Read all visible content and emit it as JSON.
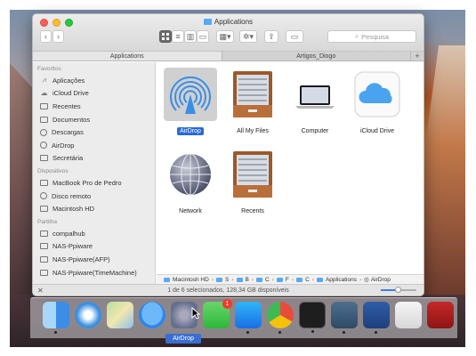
{
  "window": {
    "title": "Applications",
    "search_placeholder": "Pesquisa",
    "tabs": [
      {
        "label": "Applications",
        "active": true
      },
      {
        "label": "Artigos_Diogo",
        "active": false
      }
    ]
  },
  "sidebar": {
    "favorites_header": "Favoritos",
    "favorites": [
      {
        "label": "Aplicações",
        "icon": "applications-icon"
      },
      {
        "label": "iCloud Drive",
        "icon": "cloud-icon"
      },
      {
        "label": "Recentes",
        "icon": "recents-icon"
      },
      {
        "label": "Documentos",
        "icon": "document-icon"
      },
      {
        "label": "Descargas",
        "icon": "download-icon"
      },
      {
        "label": "AirDrop",
        "icon": "airdrop-icon"
      },
      {
        "label": "Secretária",
        "icon": "desktop-icon"
      }
    ],
    "devices_header": "Dispositivos",
    "devices": [
      {
        "label": "MacBook Pro de Pedro",
        "icon": "laptop-icon"
      },
      {
        "label": "Disco remoto",
        "icon": "disc-icon"
      },
      {
        "label": "Macintosh HD",
        "icon": "harddisk-icon"
      }
    ],
    "shared_header": "Partilha",
    "shared": [
      {
        "label": "compalhub",
        "icon": "network-drive-icon"
      },
      {
        "label": "NAS-Ppiware",
        "icon": "network-drive-icon"
      },
      {
        "label": "NAS-Ppiware(AFP)",
        "icon": "network-drive-icon"
      },
      {
        "label": "NAS-Ppiware(TimeMachine)",
        "icon": "network-drive-icon"
      }
    ]
  },
  "content": {
    "items": [
      {
        "label": "AirDrop",
        "icon": "airdrop-icon",
        "selected": true
      },
      {
        "label": "All My Files",
        "icon": "drawer-icon",
        "selected": false
      },
      {
        "label": "Computer",
        "icon": "laptop-icon",
        "selected": false
      },
      {
        "label": "iCloud Drive",
        "icon": "cloud-icon",
        "selected": false
      },
      {
        "label": "Network",
        "icon": "globe-icon",
        "selected": false
      },
      {
        "label": "Recents",
        "icon": "drawer-icon",
        "selected": false
      }
    ]
  },
  "pathbar": {
    "segments": [
      "Macintosh HD",
      "S",
      "B",
      "C",
      "F",
      "C",
      "Applications",
      "AirDrop"
    ]
  },
  "status": {
    "text": "1 de 6 selecionados, 128,34 GB disponíveis"
  },
  "dock": {
    "drag_label": "AirDrop",
    "facetime_badge": "1",
    "apps": [
      "finder-icon",
      "safari-icon",
      "maps-icon",
      "messages-icon",
      "airdrop-icon",
      "facetime-icon",
      "app-store-icon",
      "chrome-icon",
      "terminal-icon",
      "scrivener-icon",
      "word-icon",
      "notes-icon",
      "filezilla-icon"
    ]
  },
  "colors": {
    "selection": "#2a6ad8",
    "folder": "#58a9f5",
    "cloud": "#4aa3f0"
  }
}
